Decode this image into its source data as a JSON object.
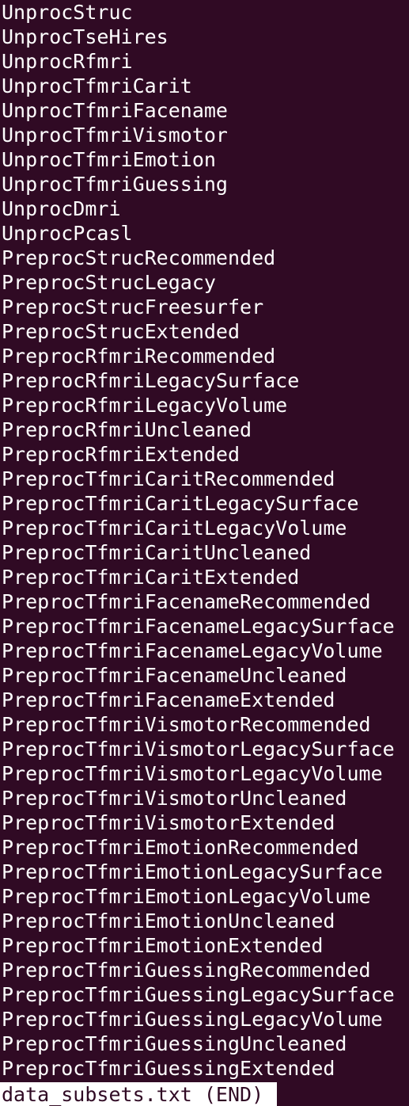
{
  "lines": [
    "UnprocStruc",
    "UnprocTseHires",
    "UnprocRfmri",
    "UnprocTfmriCarit",
    "UnprocTfmriFacename",
    "UnprocTfmriVismotor",
    "UnprocTfmriEmotion",
    "UnprocTfmriGuessing",
    "UnprocDmri",
    "UnprocPcasl",
    "PreprocStrucRecommended",
    "PreprocStrucLegacy",
    "PreprocStrucFreesurfer",
    "PreprocStrucExtended",
    "PreprocRfmriRecommended",
    "PreprocRfmriLegacySurface",
    "PreprocRfmriLegacyVolume",
    "PreprocRfmriUncleaned",
    "PreprocRfmriExtended",
    "PreprocTfmriCaritRecommended",
    "PreprocTfmriCaritLegacySurface",
    "PreprocTfmriCaritLegacyVolume",
    "PreprocTfmriCaritUncleaned",
    "PreprocTfmriCaritExtended",
    "PreprocTfmriFacenameRecommended",
    "PreprocTfmriFacenameLegacySurface",
    "PreprocTfmriFacenameLegacyVolume",
    "PreprocTfmriFacenameUncleaned",
    "PreprocTfmriFacenameExtended",
    "PreprocTfmriVismotorRecommended",
    "PreprocTfmriVismotorLegacySurface",
    "PreprocTfmriVismotorLegacyVolume",
    "PreprocTfmriVismotorUncleaned",
    "PreprocTfmriVismotorExtended",
    "PreprocTfmriEmotionRecommended",
    "PreprocTfmriEmotionLegacySurface",
    "PreprocTfmriEmotionLegacyVolume",
    "PreprocTfmriEmotionUncleaned",
    "PreprocTfmriEmotionExtended",
    "PreprocTfmriGuessingRecommended",
    "PreprocTfmriGuessingLegacySurface",
    "PreprocTfmriGuessingLegacyVolume",
    "PreprocTfmriGuessingUncleaned",
    "PreprocTfmriGuessingExtended"
  ],
  "status_bar": "data_subsets.txt (END)",
  "colors": {
    "background": "#300a24",
    "text": "#ffffff"
  }
}
